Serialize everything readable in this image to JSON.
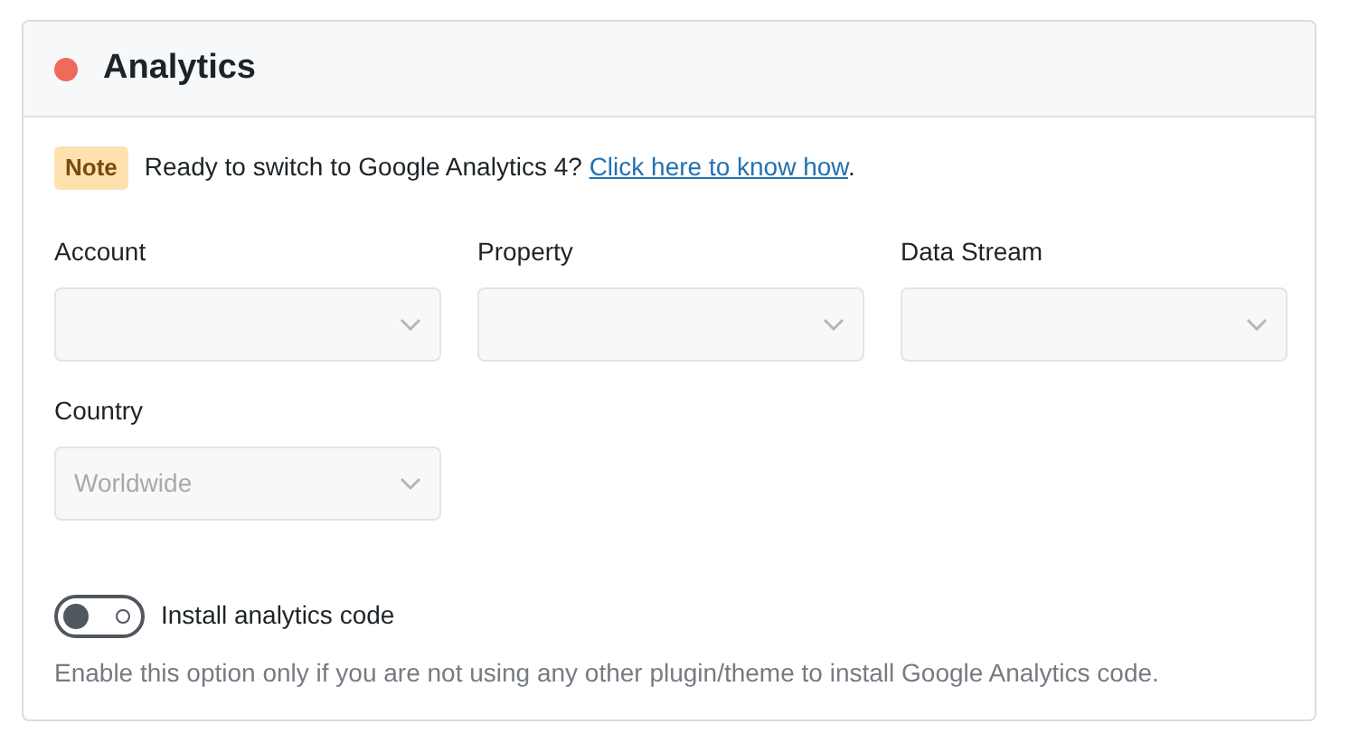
{
  "panel": {
    "title": "Analytics",
    "color": "#ef6a5a"
  },
  "notice": {
    "badge": "Note",
    "text": "Ready to switch to Google Analytics 4?",
    "link": "Click here to know how",
    "suffix": "."
  },
  "fields": [
    {
      "label": "Account",
      "disabled": true
    },
    {
      "label": "Property",
      "disabled": true
    },
    {
      "label": "Data Stream",
      "disabled": true
    },
    {
      "label": "Country",
      "value": "Worldwide",
      "disabled": true
    }
  ],
  "toggle": {
    "label": "Install analytics code",
    "on": false
  },
  "help_text": "Enable this option only if you are not using any other plugin/theme to install Google Analytics code."
}
